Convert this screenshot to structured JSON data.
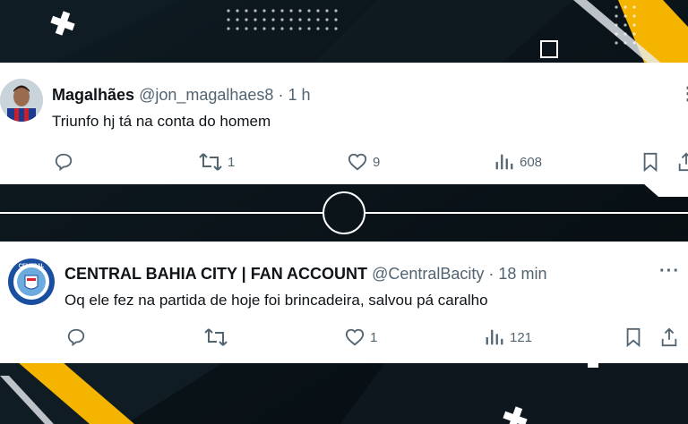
{
  "tweets": [
    {
      "display_name": "Magalhães",
      "handle": "@jon_magalhaes8",
      "separator": "·",
      "time": "1 h",
      "text": "Triunfo hj tá na conta do homem",
      "reply_count": "",
      "retweet_count": "1",
      "like_count": "9",
      "view_count": "608",
      "more_label": "⋮"
    },
    {
      "display_name": "CENTRAL BAHIA CITY | FAN ACCOUNT",
      "handle": "@CentralBacity",
      "separator": "·",
      "time": "18 min",
      "text": "Oq ele fez na partida de hoje foi brincadeira, salvou pá caralho",
      "reply_count": "",
      "retweet_count": "",
      "like_count": "1",
      "view_count": "121",
      "more_label": "···",
      "badge_text": "CENTRAL"
    }
  ],
  "colors": {
    "background": "#0b1419",
    "accent_yellow": "#f5b400",
    "text_primary": "#0f1419",
    "text_secondary": "#536471"
  },
  "icons": [
    "reply-icon",
    "retweet-icon",
    "like-icon",
    "views-icon",
    "bookmark-icon",
    "share-icon"
  ]
}
